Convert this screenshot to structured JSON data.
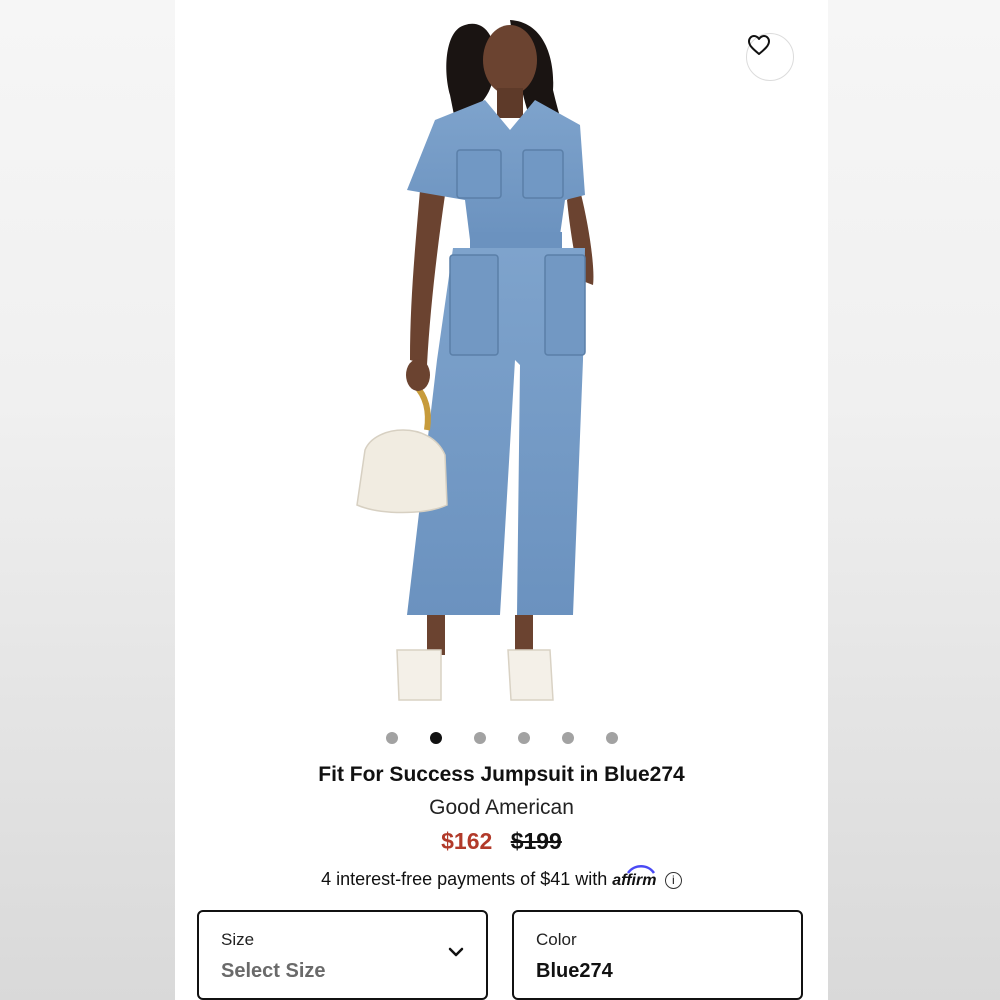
{
  "product": {
    "image_alt": "Model wearing denim jumpsuit holding white bag",
    "title": "Fit For Success Jumpsuit in Blue274",
    "brand": "Good American",
    "sale_price": "$162",
    "original_price": "$199",
    "sale_color": "#b23a2a"
  },
  "gallery": {
    "image_count": 6,
    "active_index": 1
  },
  "financing": {
    "text": "4 interest-free payments of $41 with",
    "provider": "affirm",
    "info_icon": "info-icon"
  },
  "selectors": {
    "size": {
      "label": "Size",
      "placeholder": "Select Size"
    },
    "color": {
      "label": "Color",
      "value": "Blue274"
    }
  },
  "icons": {
    "wishlist": "heart-icon",
    "dropdown": "chevron-down-icon"
  }
}
